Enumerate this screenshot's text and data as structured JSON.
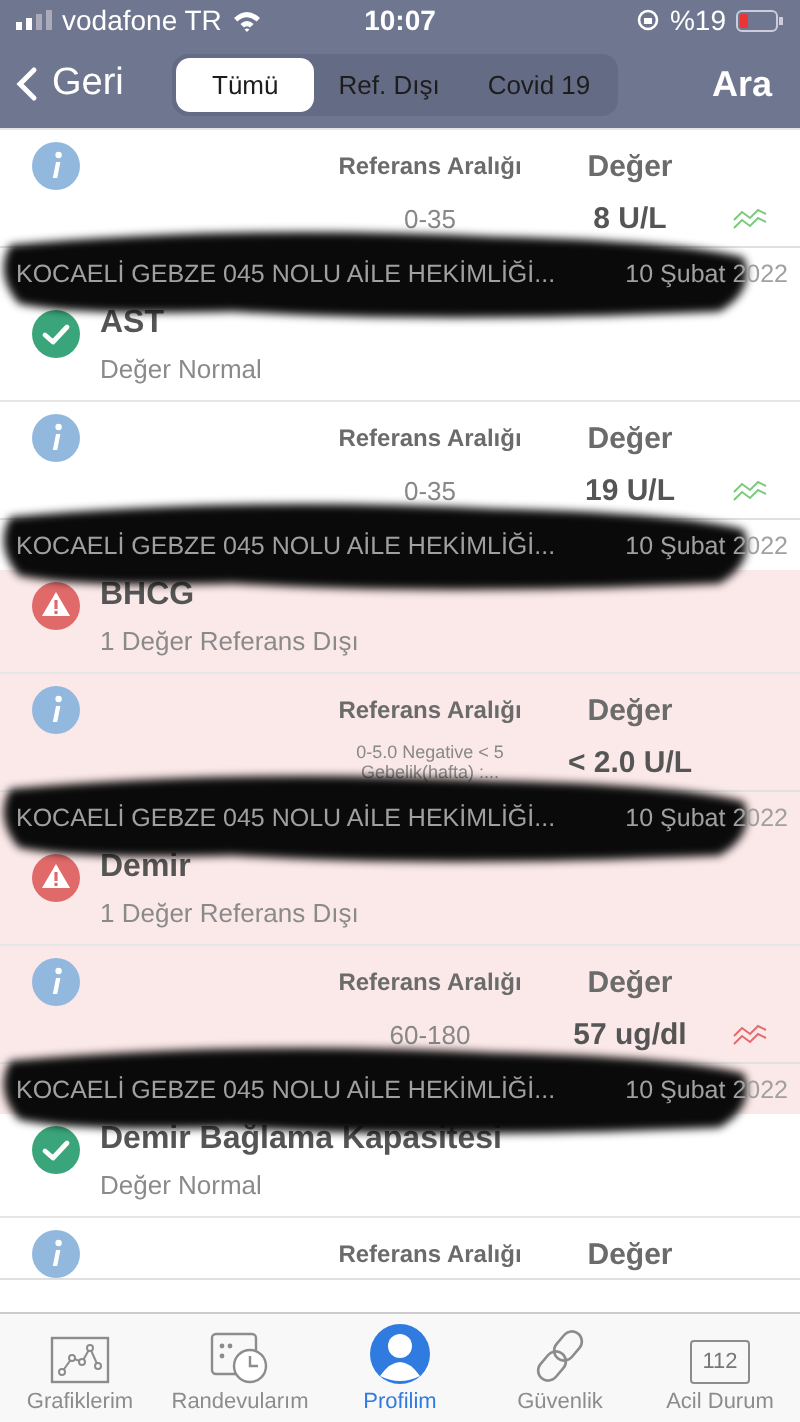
{
  "status_bar": {
    "carrier": "vodafone TR",
    "time": "10:07",
    "battery": "%19"
  },
  "nav": {
    "back": "Geri",
    "segments": [
      {
        "label": "Tümü",
        "selected": true
      },
      {
        "label": "Ref. Dışı",
        "selected": false
      },
      {
        "label": "Covid 19",
        "selected": false
      }
    ],
    "action": "Ara"
  },
  "tests": [
    {
      "out_of_range": false,
      "range_label": "Referans Aralığı",
      "value_label": "Değer",
      "range": [
        "0-35"
      ],
      "value": "8 U/L",
      "trend": true,
      "source": "KOCAELİ GEBZE 045 NOLU AİLE HEKİMLİĞİ...",
      "date": "10 Şubat 2022"
    },
    {
      "name": "AST",
      "summary": "Değer Normal",
      "out_of_range": false,
      "range_label": "Referans Aralığı",
      "value_label": "Değer",
      "range": [
        "0-35"
      ],
      "value": "19 U/L",
      "trend": true,
      "source": "KOCAELİ GEBZE 045 NOLU AİLE HEKİMLİĞİ...",
      "date": "10 Şubat 2022"
    },
    {
      "name": "BHCG",
      "summary": "1 Değer Referans Dışı",
      "out_of_range": true,
      "range_label": "Referans Aralığı",
      "value_label": "Değer",
      "range": [
        "0-5.0  Negative < 5",
        "Gebelik(hafta) :..."
      ],
      "value": "< 2.0 U/L",
      "trend": false,
      "source": "KOCAELİ GEBZE 045 NOLU AİLE HEKİMLİĞİ...",
      "date": "10 Şubat 2022"
    },
    {
      "name": "Demir",
      "summary": "1 Değer Referans Dışı",
      "out_of_range": true,
      "range_label": "Referans Aralığı",
      "value_label": "Değer",
      "range": [
        "60-180"
      ],
      "value": "57 ug/dl",
      "trend": true,
      "source": "KOCAELİ GEBZE 045 NOLU AİLE HEKİMLİĞİ...",
      "date": "10 Şubat 2022"
    },
    {
      "name": "Demir Bağlama Kapasitesi",
      "summary": "Değer Normal",
      "out_of_range": false,
      "range_label": "Referans Aralığı",
      "value_label": "Değer"
    }
  ],
  "tab_bar": [
    {
      "label": "Grafiklerim",
      "kind": "chart",
      "selected": false
    },
    {
      "label": "Randevularım",
      "kind": "calendar",
      "selected": false
    },
    {
      "label": "Profilim",
      "kind": "person",
      "selected": true
    },
    {
      "label": "Güvenlik",
      "kind": "link",
      "selected": false
    },
    {
      "label": "Acil Durum",
      "kind": "badge",
      "badge": "112",
      "selected": false
    }
  ]
}
